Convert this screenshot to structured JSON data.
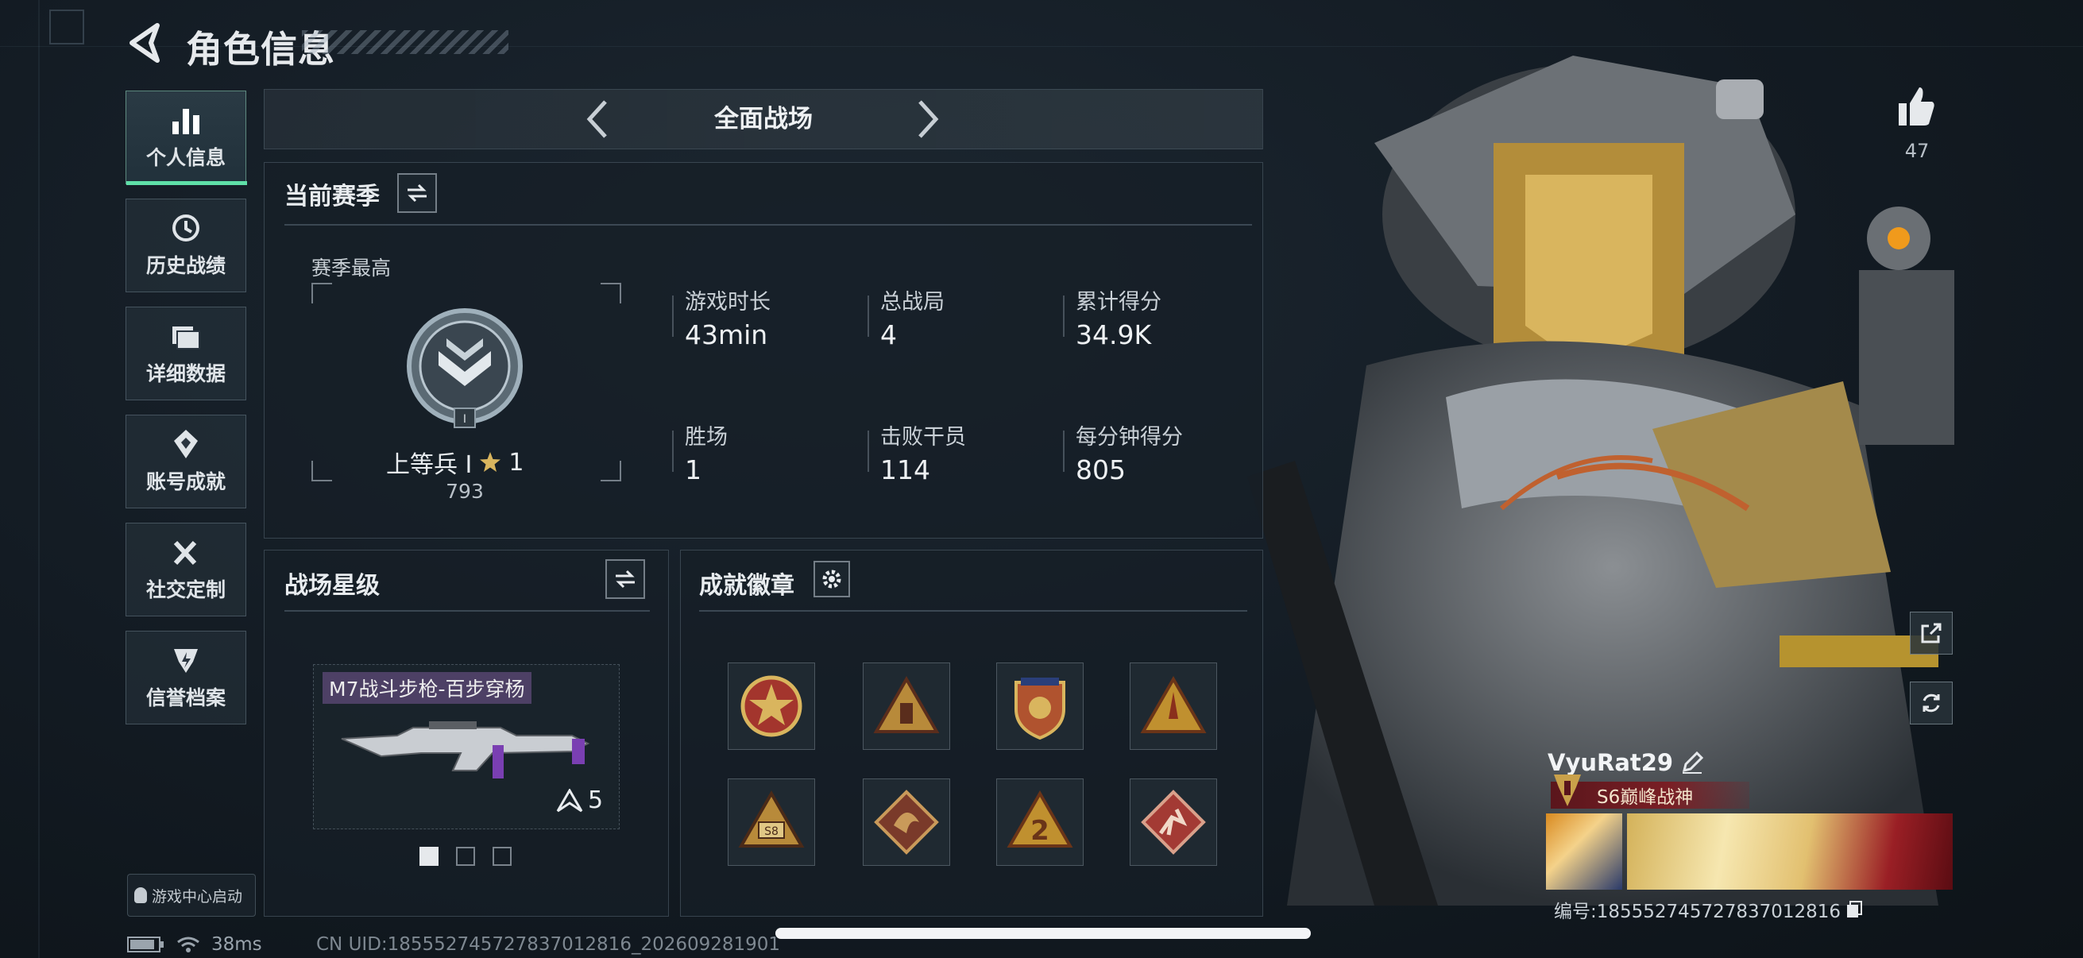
{
  "header": {
    "title": "角色信息"
  },
  "sidebar": {
    "items": [
      {
        "label": "个人信息",
        "icon": "bar-chart-icon",
        "active": true
      },
      {
        "label": "历史战绩",
        "icon": "history-icon",
        "active": false
      },
      {
        "label": "详细数据",
        "icon": "folder-icon",
        "active": false
      },
      {
        "label": "账号成就",
        "icon": "achievement-icon",
        "active": false
      },
      {
        "label": "社交定制",
        "icon": "tools-icon",
        "active": false
      },
      {
        "label": "信誉档案",
        "icon": "credit-icon",
        "active": false
      }
    ],
    "game_center": "游戏中心启动"
  },
  "mode": {
    "label": "全面战场"
  },
  "season": {
    "title": "当前赛季",
    "best_label": "赛季最高",
    "rank_name": "上等兵 Ⅰ",
    "rank_stars": "1",
    "rank_score": "793",
    "stats": [
      {
        "key": "游戏时长",
        "value": "43min"
      },
      {
        "key": "总战局",
        "value": "4"
      },
      {
        "key": "累计得分",
        "value": "34.9K"
      },
      {
        "key": "胜场",
        "value": "1"
      },
      {
        "key": "击败干员",
        "value": "114"
      },
      {
        "key": "每分钟得分",
        "value": "805"
      }
    ]
  },
  "star_level": {
    "title": "战场星级",
    "weapon_name": "M7战斗步枪-百步穿杨",
    "weapon_level": "5",
    "page_index": 1,
    "page_count": 3
  },
  "badges": {
    "title": "成就徽章",
    "items": [
      "star-shield-badge-icon",
      "triangle-badge-icon",
      "crest-badge-icon",
      "rocket-badge-icon",
      "s8-badge-icon",
      "dragon-badge-icon",
      "number-two-badge-icon",
      "runner-badge-icon"
    ]
  },
  "profile": {
    "likes": "47",
    "player_name": "VyuRat29",
    "title_badge": "S6巅峰战神",
    "id_label": "编号:1855527457278370128​16"
  },
  "status": {
    "ping": "38ms",
    "uid": "CN UID:1855527457278370128​16_202609281901"
  },
  "colors": {
    "accent": "#5fe0a8",
    "gold": "#c9a14a",
    "title_red": "#7a1f25"
  }
}
